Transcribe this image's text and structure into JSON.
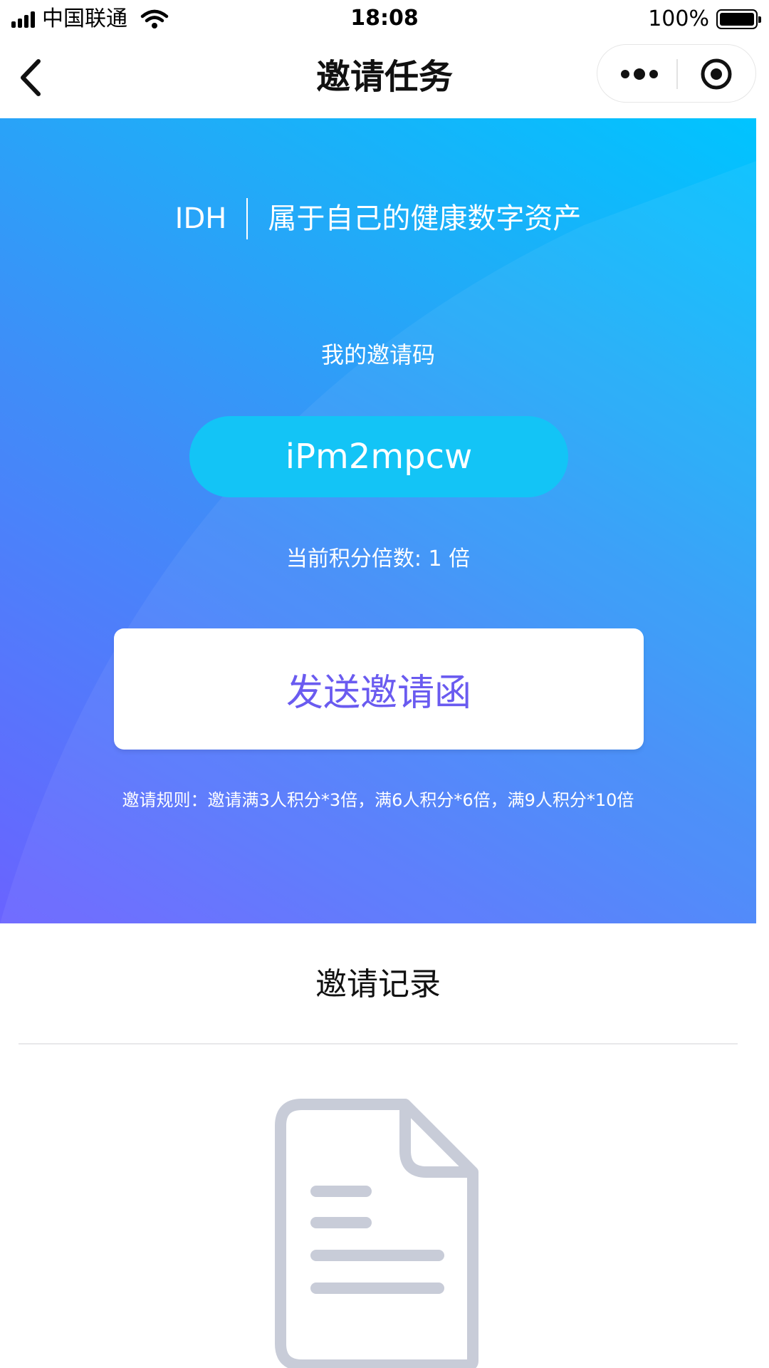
{
  "status_bar": {
    "carrier": "中国联通",
    "time": "18:08",
    "battery": "100%",
    "icons": [
      "signal-icon",
      "wifi-icon",
      "battery-icon"
    ]
  },
  "nav": {
    "title": "邀请任务",
    "icons": [
      "back-chevron-icon",
      "more-dots-icon",
      "target-icon"
    ]
  },
  "hero": {
    "brand": "IDH",
    "slogan": "属于自己的健康数字资产",
    "my_code_label": "我的邀请码",
    "invite_code": "iPm2mpcw",
    "multiplier_text": "当前积分倍数: 1 倍",
    "send_button": "发送邀请函",
    "rules": "邀请规则：邀请满3人积分*3倍，满6人积分*6倍，满9人积分*10倍"
  },
  "records": {
    "title": "邀请记录",
    "empty_icon": "empty-document-icon"
  },
  "colors": {
    "gradient_start": "#6a63ff",
    "gradient_end": "#00c4ff",
    "code_pill": "#13c4f6",
    "button_text": "#6a5bf0",
    "empty_icon": "#c8ccd8"
  }
}
